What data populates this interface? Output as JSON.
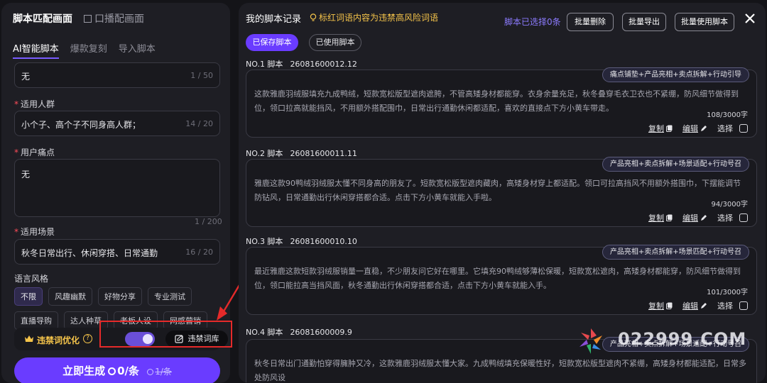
{
  "left": {
    "mode_tabs": [
      "脚本匹配画面",
      "口播配画面"
    ],
    "sub_tabs": [
      "AI智能脚本",
      "爆款复刻",
      "导入脚本"
    ],
    "fields": [
      {
        "label": "",
        "value": "无",
        "count": "1 / 50"
      },
      {
        "label": "适用人群",
        "value": "小个子、高个子不同身高人群；",
        "count": "14 / 20"
      },
      {
        "label": "用户痛点",
        "value": "无",
        "count": "1 / 200"
      },
      {
        "label": "适用场景",
        "value": "秋冬日常出行、休闲穿搭、日常通勤",
        "count": "16 / 20"
      }
    ],
    "language_style_label": "语言风格",
    "styles_row1": [
      "不限",
      "风趣幽默",
      "好物分享",
      "专业测试"
    ],
    "styles_row2": [
      "直播导购",
      "达人种草",
      "老板人设",
      "网感营销"
    ],
    "optimize_label": "违禁词优化",
    "help_icon": "?",
    "lexicon_button": "违禁词库",
    "generate": {
      "label": "立即生成",
      "price": "0/条",
      "old_price": "1/条"
    }
  },
  "right": {
    "title": "我的脚本记录",
    "warning": "标红词语内容为违禁高风险词语",
    "selected_text": "脚本已选择0条",
    "buttons": [
      "批量删除",
      "批量导出",
      "批量使用脚本"
    ],
    "tabs": [
      "已保存脚本",
      "已使用脚本"
    ],
    "action_copy": "复制",
    "action_edit": "编辑",
    "action_select": "选择",
    "records": [
      {
        "no": "NO.1 脚本",
        "id": "26081600012.12",
        "tag": "痛点铺垫+产品亮相+卖点拆解+行动引导",
        "text": "这款雅鹿羽绒服填充九成鸭绒，短款宽松版型遮肉遮胯，不管高矮身材都能穿。衣身余量充足，秋冬叠穿毛衣卫衣也不紧绷，防风细节做得到位，领口拉高就能挡风，不用额外搭配围巾，日常出行通勤休闲都适配，喜欢的直接点下方小黄车带走。",
        "count": "108/3000字"
      },
      {
        "no": "NO.2 脚本",
        "id": "26081600011.11",
        "tag": "产品亮相+卖点拆解+场景适配+行动号召",
        "text": "雅鹿这款90鸭绒羽绒服太懂不同身高的朋友了。短款宽松版型遮肉藏肉，高矮身材穿上都适配。领口可拉高挡风不用额外搭围巾，下摆能调节防钻风，日常通勤出行休闲穿搭都合适。点击下方小黄车就能入手啦。",
        "count": "94/3000字"
      },
      {
        "no": "NO.3 脚本",
        "id": "26081600010.10",
        "tag": "产品亮相+卖点拆解+场景匹配+行动号召",
        "text": "最近雅鹿这款短款羽绒服销量一直稳，不少朋友问它好在哪里。它填充90鸭绒够薄松保暖，短款宽松遮肉，高矮身材都能穿，防风细节做得到位，领口能拉高当挡风面，秋冬通勤出行休闲穿搭都合适，点击下方小黄车就能入手。",
        "count": "101/3000字"
      },
      {
        "no": "NO.4 脚本",
        "id": "26081600009.9",
        "tag": "产品亮相+卖点拆解+场景适配+行动号召",
        "text": "秋冬日常出门通勤怕穿得臃肿又冷，这款雅鹿羽绒服太懂大家。九成鸭绒填充保暖性好，短款宽松版型遮肉不紧绷，高矮身材都能适配，日常多处防风设",
        "count": ""
      }
    ]
  },
  "watermark": "022999.COM"
}
